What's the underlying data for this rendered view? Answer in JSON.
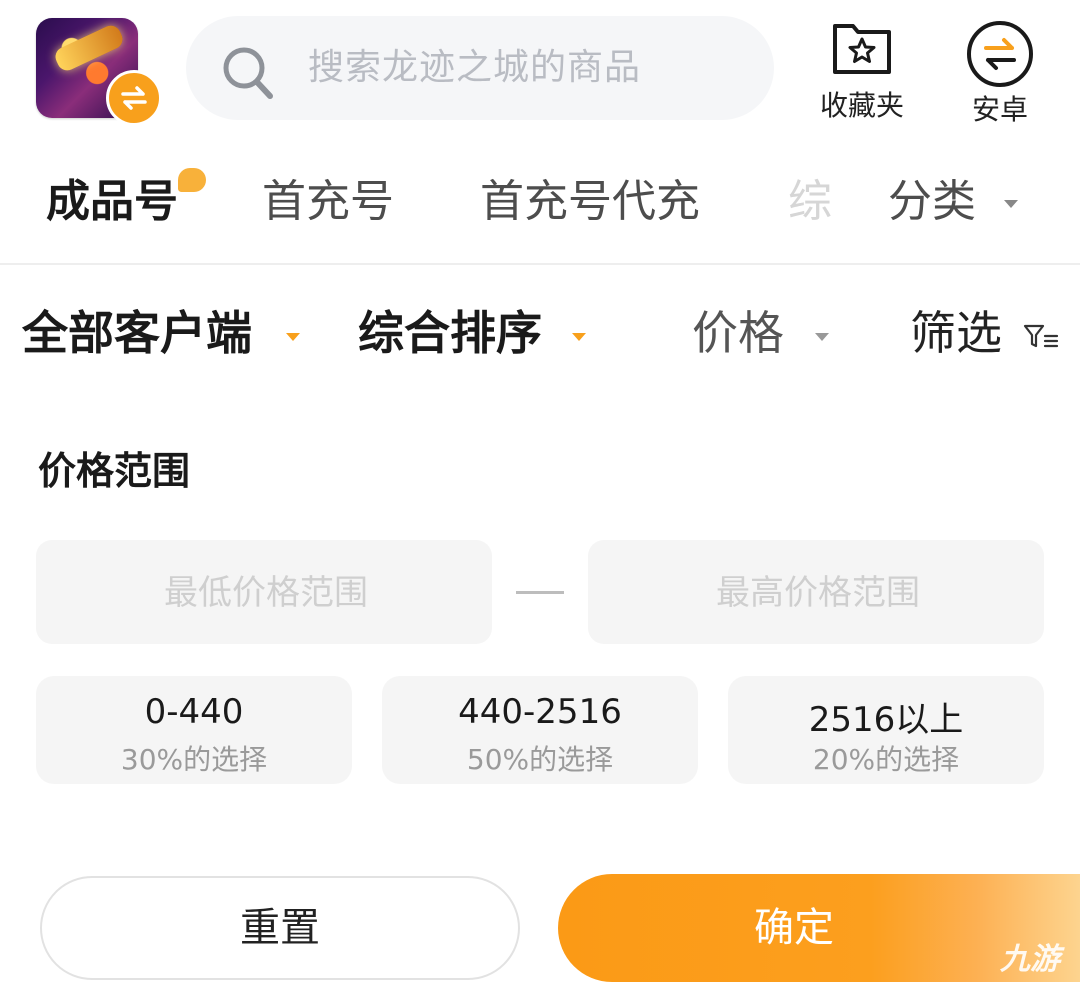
{
  "header": {
    "search_placeholder": "搜索龙迹之城的商品",
    "favorites_label": "收藏夹",
    "platform_label": "安卓"
  },
  "tabs": [
    {
      "label": "成品号",
      "active": true
    },
    {
      "label": "首充号"
    },
    {
      "label": "首充号代充"
    },
    {
      "label": "综"
    },
    {
      "label": "分类"
    }
  ],
  "filters": {
    "client": "全部客户端",
    "sort": "综合排序",
    "price": "价格",
    "filter": "筛选"
  },
  "price_range": {
    "title": "价格范围",
    "min_placeholder": "最低价格范围",
    "max_placeholder": "最高价格范围",
    "presets": [
      {
        "range": "0-440",
        "pct": "30%的选择"
      },
      {
        "range": "440-2516",
        "pct": "50%的选择"
      },
      {
        "range": "2516以上",
        "pct": "20%的选择"
      }
    ]
  },
  "actions": {
    "reset": "重置",
    "confirm": "确定"
  },
  "watermark": "九游",
  "colors": {
    "accent": "#f8a01c",
    "confirm": "#fb9a16",
    "search_bg": "#f5f6f8"
  }
}
